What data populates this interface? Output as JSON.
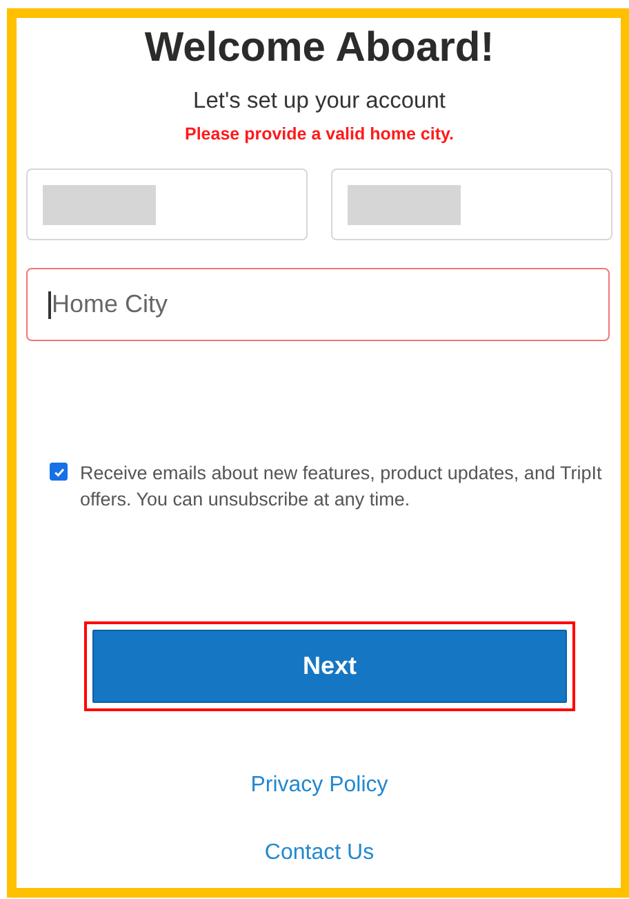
{
  "title": "Welcome Aboard!",
  "subtitle": "Let's set up your account",
  "error": "Please provide a valid home city.",
  "name_fields": [
    {
      "redacted": true
    },
    {
      "redacted": true
    }
  ],
  "home_city": {
    "placeholder": "Home City",
    "invalid": true,
    "focused": true
  },
  "consent": {
    "label": "Receive emails about new features, product updates, and TripIt offers. You can unsubscribe at any time.",
    "checked": true
  },
  "next_button": {
    "label": "Next",
    "highlighted": true
  },
  "links": [
    "Privacy Policy",
    "Contact Us"
  ]
}
